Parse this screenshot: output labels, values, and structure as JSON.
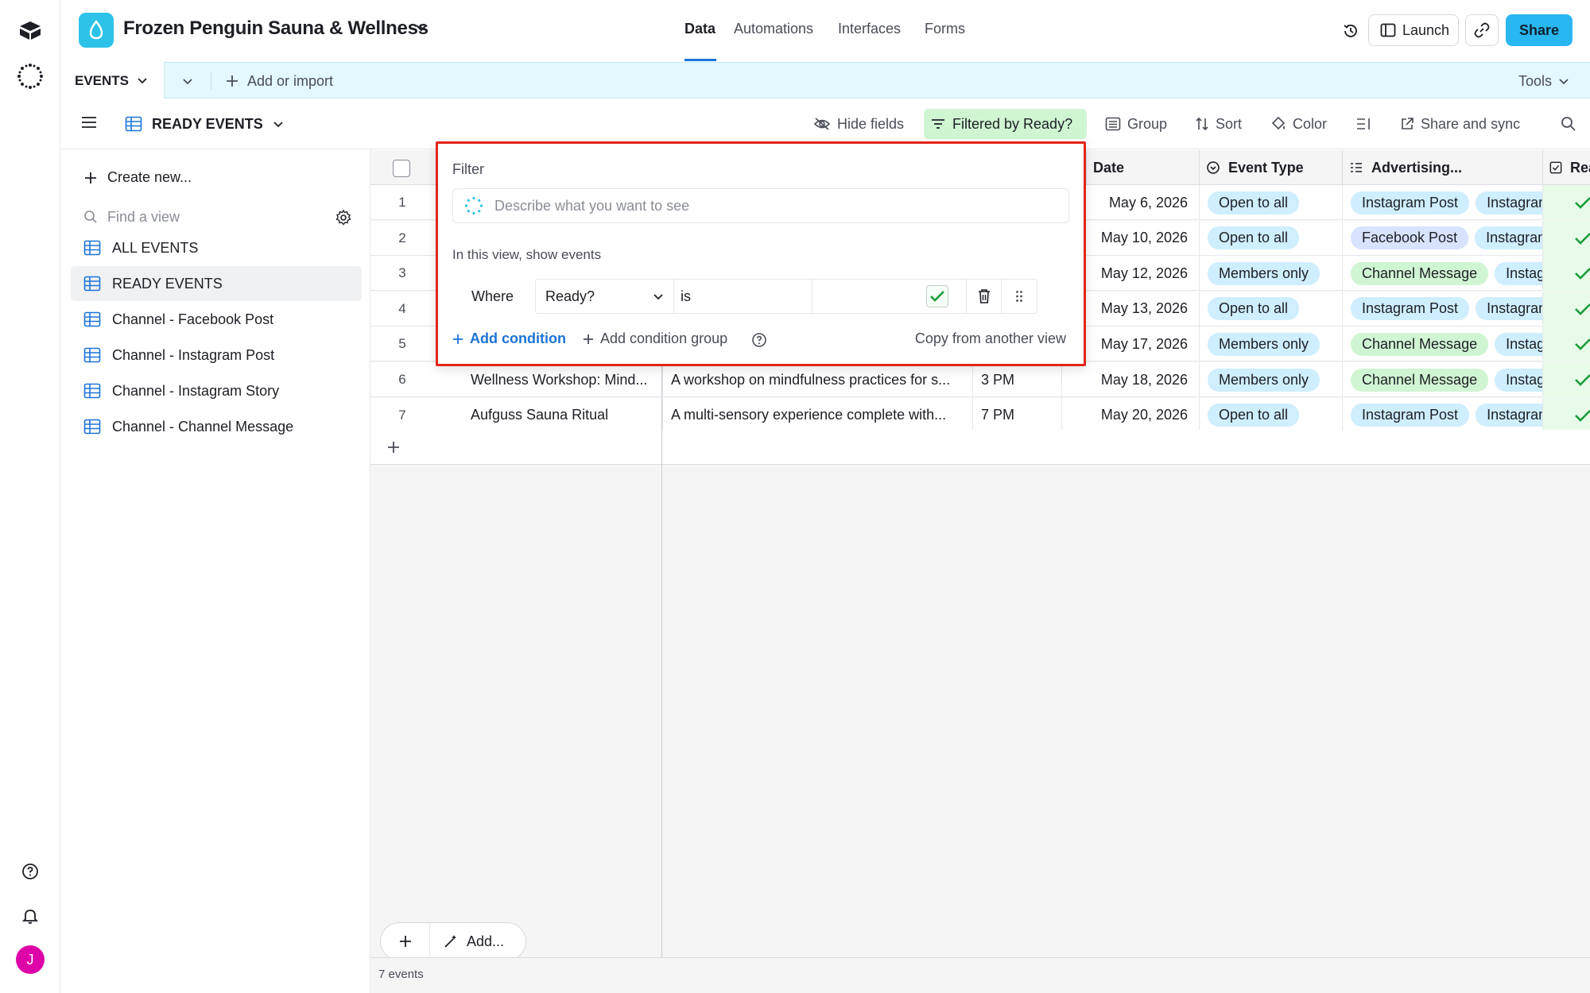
{
  "base": {
    "title": "Frozen Penguin Sauna & Wellness"
  },
  "top_tabs": [
    "Data",
    "Automations",
    "Interfaces",
    "Forms"
  ],
  "top_actions": {
    "launch": "Launch",
    "share": "Share"
  },
  "table_tab": {
    "name": "EVENTS",
    "add_import": "Add or import",
    "tools": "Tools"
  },
  "view": {
    "name": "READY EVENTS"
  },
  "toolbar": {
    "hide_fields": "Hide fields",
    "filter": "Filtered by Ready?",
    "group": "Group",
    "sort": "Sort",
    "color": "Color",
    "share_sync": "Share and sync"
  },
  "sidebar": {
    "create_new": "Create new...",
    "find_placeholder": "Find a view",
    "views": [
      "ALL EVENTS",
      "READY EVENTS",
      "Channel - Facebook Post",
      "Channel - Instagram Post",
      "Channel - Instagram Story",
      "Channel - Channel Message"
    ]
  },
  "grid": {
    "columns": [
      "Date",
      "Event Type",
      "Advertising...",
      "Ready?"
    ],
    "rows": [
      {
        "num": "1",
        "name": "",
        "desc": "",
        "time": "",
        "date": "May 6, 2026",
        "type": "Open to all",
        "ads": [
          "Instagram Post",
          "Instagram Story"
        ]
      },
      {
        "num": "2",
        "name": "",
        "desc": "",
        "time": "",
        "date": "May 10, 2026",
        "type": "Open to all",
        "ads": [
          "Facebook Post",
          "Instagram Post"
        ]
      },
      {
        "num": "3",
        "name": "",
        "desc": "",
        "time": "",
        "date": "May 12, 2026",
        "type": "Members only",
        "ads": [
          "Channel Message",
          "Instagram Story"
        ]
      },
      {
        "num": "4",
        "name": "",
        "desc": "",
        "time": "",
        "date": "May 13, 2026",
        "type": "Open to all",
        "ads": [
          "Instagram Post",
          "Instagram Story"
        ]
      },
      {
        "num": "5",
        "name": "",
        "desc": "",
        "time": "",
        "date": "May 17, 2026",
        "type": "Members only",
        "ads": [
          "Channel Message",
          "Instagram Story"
        ]
      },
      {
        "num": "6",
        "name": "Wellness Workshop: Mind...",
        "desc": "A workshop on mindfulness practices for s...",
        "time": "3 PM",
        "date": "May 18, 2026",
        "type": "Members only",
        "ads": [
          "Channel Message",
          "Instagram Story"
        ]
      },
      {
        "num": "7",
        "name": "Aufguss Sauna Ritual",
        "desc": "A multi-sensory experience complete with...",
        "time": "7 PM",
        "date": "May 20, 2026",
        "type": "Open to all",
        "ads": [
          "Instagram Post",
          "Instagram Story"
        ]
      }
    ],
    "add_label": "Add...",
    "record_count": "7 events"
  },
  "filter": {
    "title": "Filter",
    "ai_placeholder": "Describe what you want to see",
    "description": "In this view, show events",
    "where": "Where",
    "field": "Ready?",
    "operator": "is",
    "add_condition": "Add condition",
    "add_condition_group": "Add condition group",
    "copy_from": "Copy from another view"
  },
  "user": {
    "initial": "J"
  },
  "colors": {
    "accent": "#1b74d8",
    "share": "#2ab6ef",
    "highlight": "#e2251a",
    "filter_active": "#cff5d1"
  }
}
